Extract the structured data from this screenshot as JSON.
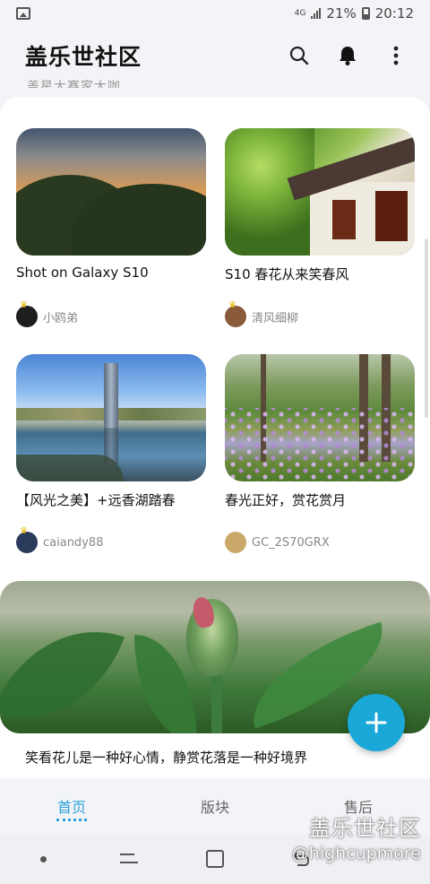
{
  "statusbar": {
    "network": "4G",
    "battery": "21%",
    "time": "20:12",
    "icons": [
      "gallery-icon",
      "signal-icon",
      "battery-icon"
    ]
  },
  "header": {
    "title": "盖乐世社区",
    "icons": [
      "search-icon",
      "bell-icon",
      "more-icon"
    ]
  },
  "peek": {
    "text": "盖星大赛家大咖"
  },
  "cards": [
    {
      "title": "Shot on Galaxy S10",
      "author": "小鸥弟",
      "avatar_color": "#1e1e1e"
    },
    {
      "title": "S10 春花从来笑春风",
      "author": "清风细柳",
      "avatar_color": "#8a5a3a"
    },
    {
      "title": "【风光之美】+远香湖踏春",
      "author": "caiandy88",
      "avatar_color": "#2a3a5a"
    },
    {
      "title": "春光正好，赏花赏月",
      "author": "GC_2S70GRX",
      "avatar_color": "#c9a86a"
    }
  ],
  "wide_card": {
    "title": "笑看花儿是一种好心情，静赏花落是一种好境界"
  },
  "fab": {
    "label": "+",
    "color": "#19a8d8"
  },
  "tabs": [
    {
      "label": "首页",
      "active": true
    },
    {
      "label": "版块",
      "active": false
    },
    {
      "label": "售后",
      "active": false
    }
  ],
  "watermark": {
    "name": "盖乐世社区",
    "handle": "@highcupmore"
  },
  "colors": {
    "accent": "#2aa2d6",
    "fab": "#19a8d8"
  }
}
